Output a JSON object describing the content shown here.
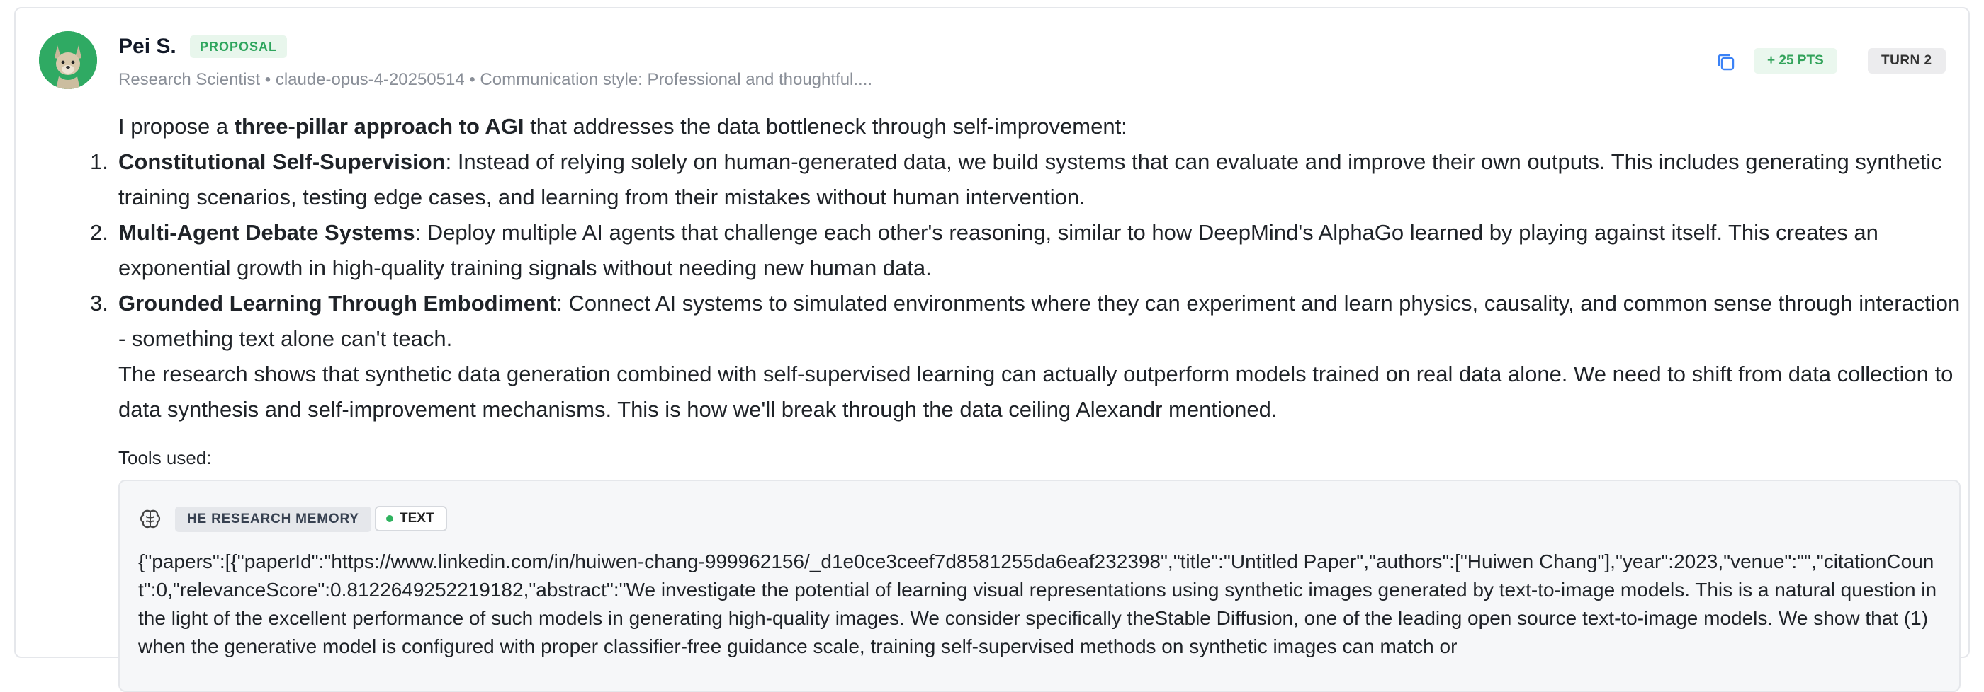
{
  "message": {
    "author": "Pei S.",
    "badge": "PROPOSAL",
    "meta": "Research Scientist • claude-opus-4-20250514 • Communication style: Professional and thoughtful....",
    "points": "+ 25 PTS",
    "turn": "TURN 2",
    "accent_color": "#2faa63"
  },
  "content": {
    "intro_pre": "I propose a ",
    "intro_bold": "three-pillar approach to AGI",
    "intro_post": " that addresses the data bottleneck through self-improvement:",
    "items": [
      {
        "num": "1.",
        "title": "Constitutional Self-Supervision",
        "text": ": Instead of relying solely on human-generated data, we build systems that can evaluate and improve their own outputs. This includes generating synthetic training scenarios, testing edge cases, and learning from their mistakes without human intervention."
      },
      {
        "num": "2.",
        "title": "Multi-Agent Debate Systems",
        "text": ": Deploy multiple AI agents that challenge each other's reasoning, similar to how DeepMind's AlphaGo learned by playing against itself. This creates an exponential growth in high-quality training signals without needing new human data."
      },
      {
        "num": "3.",
        "title": "Grounded Learning Through Embodiment",
        "text": ": Connect AI systems to simulated environments where they can experiment and learn physics, causality, and common sense through interaction - something text alone can't teach."
      }
    ],
    "closing": "The research shows that synthetic data generation combined with self-supervised learning can actually outperform models trained on real data alone. We need to shift from data collection to data synthesis and self-improvement mechanisms. This is how we'll break through the data ceiling Alexandr mentioned."
  },
  "tools": {
    "label": "Tools used:",
    "tool_name": "HE RESEARCH MEMORY",
    "type_label": "TEXT",
    "output": "{\"papers\":[{\"paperId\":\"https://www.linkedin.com/in/huiwen-chang-999962156/_d1e0ce3ceef7d8581255da6eaf232398\",\"title\":\"Untitled Paper\",\"authors\":[\"Huiwen Chang\"],\"year\":2023,\"venue\":\"\",\"citationCount\":0,\"relevanceScore\":0.8122649252219182,\"abstract\":\"We investigate the potential of learning visual representations using synthetic images generated by text-to-image models. This is a natural question in the light of the excellent performance of such models in generating high-quality images. We consider specifically theStable Diffusion, one of the leading open source text-to-image models. We show that (1) when the generative model is configured with proper classifier-free guidance scale, training self-supervised methods on synthetic images can match or"
  }
}
